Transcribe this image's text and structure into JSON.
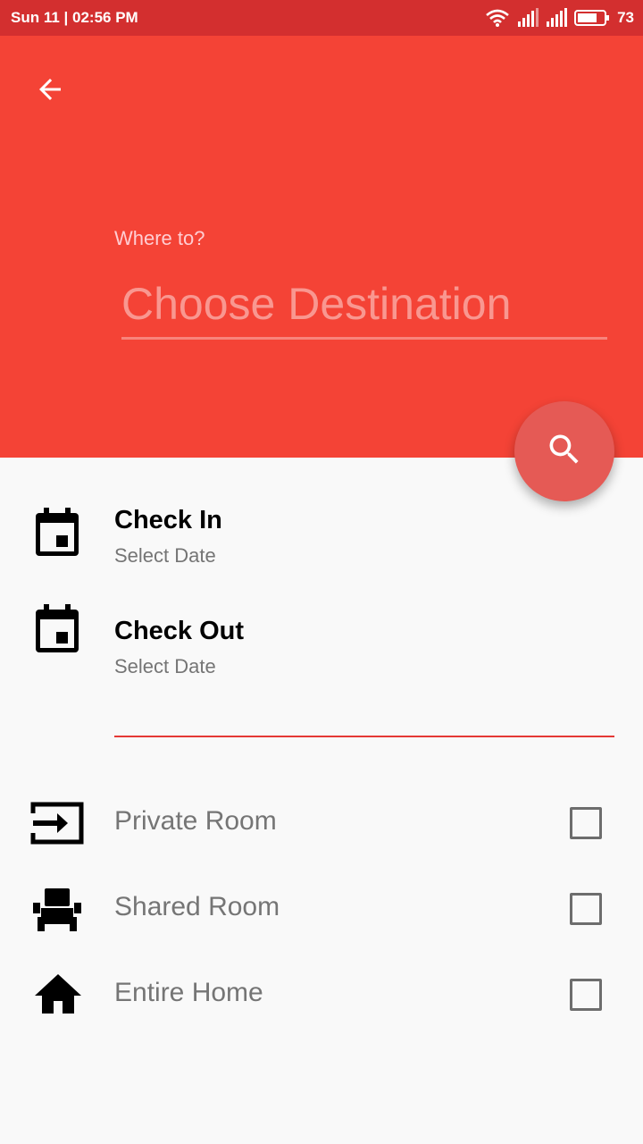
{
  "status_bar": {
    "time": "Sun 11 | 02:56 PM",
    "battery": "73",
    "icons": [
      "wifi-icon",
      "signal-icon",
      "signal-icon",
      "battery-icon"
    ]
  },
  "header": {
    "back_icon": "arrow-back-icon",
    "label": "Where to?",
    "placeholder": "Choose Destination",
    "value": ""
  },
  "fab": {
    "icon": "search-icon"
  },
  "dates": [
    {
      "title": "Check In",
      "subtitle": "Select Date",
      "icon": "calendar-icon"
    },
    {
      "title": "Check Out",
      "subtitle": "Select Date",
      "icon": "calendar-icon"
    }
  ],
  "rooms": [
    {
      "label": "Private Room",
      "icon": "private-room-icon",
      "checked": false
    },
    {
      "label": "Shared Room",
      "icon": "shared-room-icon",
      "checked": false
    },
    {
      "label": "Entire Home",
      "icon": "home-icon",
      "checked": false
    }
  ],
  "colors": {
    "status_bar": "#d32f2f",
    "header": "#f44336",
    "fab": "#e55a55",
    "divider": "#e53935",
    "background": "#f9f9f9"
  }
}
